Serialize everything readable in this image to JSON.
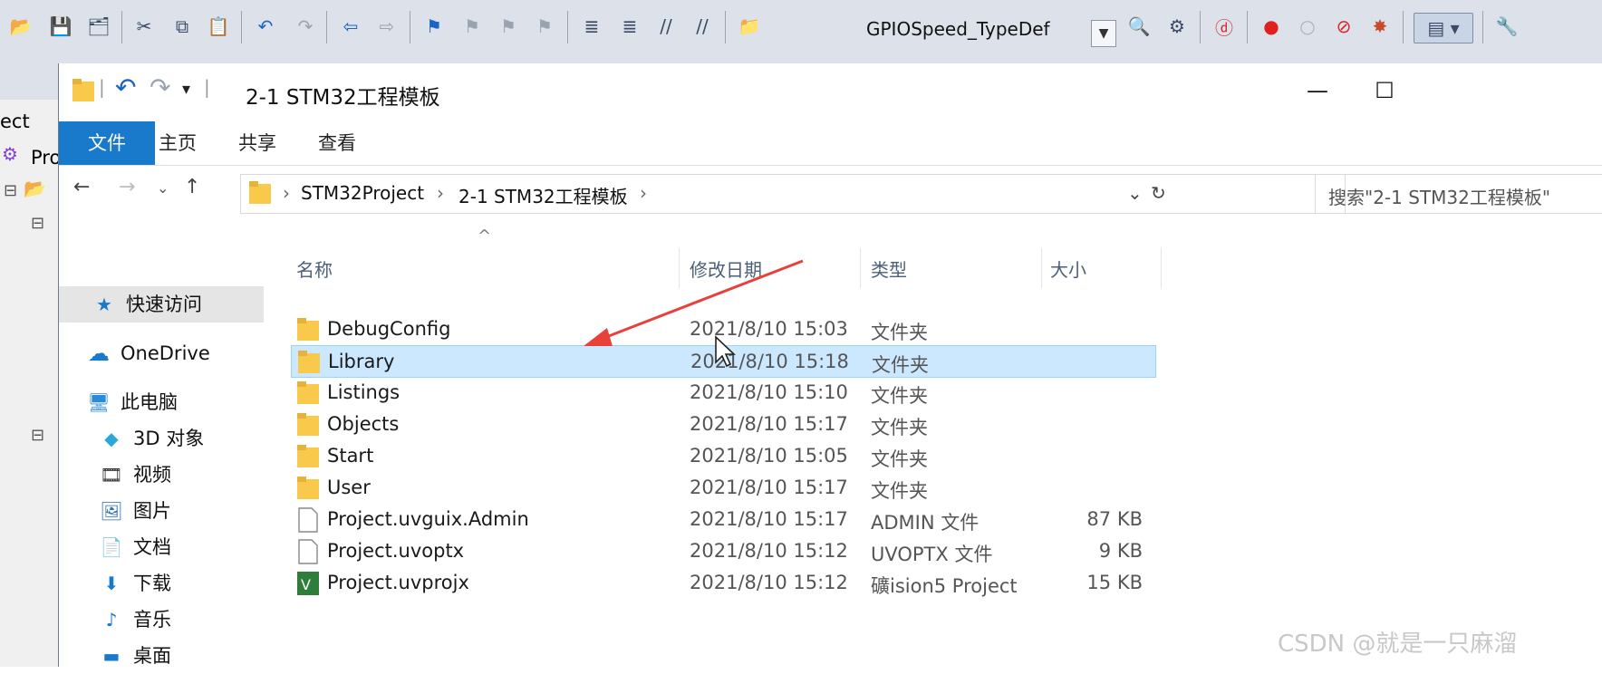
{
  "keil": {
    "device_combo": "GPIOSpeed_TypeDef",
    "left_texts": [
      "ect",
      "Pro"
    ],
    "toolbar_icons": [
      "open-icon",
      "save-icon",
      "save-all-icon",
      "cut-icon",
      "copy-icon",
      "paste-icon",
      "undo-icon",
      "redo-icon",
      "nav-back-icon",
      "nav-forward-icon",
      "bookmark-icon",
      "bookmark-prev-icon",
      "bookmark-next-icon",
      "bookmark-clear-icon",
      "indent-icon",
      "unindent-icon",
      "comment-icon",
      "uncomment-icon",
      "find-in-files-icon",
      "find-icon",
      "debug-icon",
      "breakpoint-icon",
      "breakpoint-disable-icon",
      "breakpoint-kill-icon",
      "breakpoint-all-icon",
      "window-layout-icon",
      "config-wrench-icon"
    ]
  },
  "explorer": {
    "title": "2-1 STM32工程模板",
    "window_buttons": [
      "—",
      "☐"
    ],
    "ribbon_tabs": [
      "文件",
      "主页",
      "共享",
      "查看"
    ],
    "breadcrumb": [
      "STM32Project",
      "2-1 STM32工程模板"
    ],
    "search_placeholder": "搜索\"2-1 STM32工程模板\"",
    "nav_items": [
      {
        "label": "快速访问",
        "icon": "star-icon"
      },
      {
        "label": "OneDrive",
        "icon": "cloud-icon"
      },
      {
        "label": "此电脑",
        "icon": "computer-icon"
      },
      {
        "label": "3D 对象",
        "icon": "cube-icon"
      },
      {
        "label": "视频",
        "icon": "video-icon"
      },
      {
        "label": "图片",
        "icon": "picture-icon"
      },
      {
        "label": "文档",
        "icon": "document-icon"
      },
      {
        "label": "下载",
        "icon": "download-icon"
      },
      {
        "label": "音乐",
        "icon": "music-icon"
      },
      {
        "label": "桌面",
        "icon": "desktop-icon"
      }
    ],
    "columns": [
      "名称",
      "修改日期",
      "类型",
      "大小"
    ],
    "files": [
      {
        "name": "DebugConfig",
        "date": "2021/8/10 15:03",
        "type": "文件夹",
        "size": "",
        "kind": "folder"
      },
      {
        "name": "Library",
        "date": "2021/8/10 15:18",
        "type": "文件夹",
        "size": "",
        "kind": "folder",
        "selected": true
      },
      {
        "name": "Listings",
        "date": "2021/8/10 15:10",
        "type": "文件夹",
        "size": "",
        "kind": "folder"
      },
      {
        "name": "Objects",
        "date": "2021/8/10 15:17",
        "type": "文件夹",
        "size": "",
        "kind": "folder"
      },
      {
        "name": "Start",
        "date": "2021/8/10 15:05",
        "type": "文件夹",
        "size": "",
        "kind": "folder"
      },
      {
        "name": "User",
        "date": "2021/8/10 15:17",
        "type": "文件夹",
        "size": "",
        "kind": "folder"
      },
      {
        "name": "Project.uvguix.Admin",
        "date": "2021/8/10 15:17",
        "type": "ADMIN 文件",
        "size": "87 KB",
        "kind": "file"
      },
      {
        "name": "Project.uvoptx",
        "date": "2021/8/10 15:12",
        "type": "UVOPTX 文件",
        "size": "9 KB",
        "kind": "file"
      },
      {
        "name": "Project.uvprojx",
        "date": "2021/8/10 15:12",
        "type": "礦ision5 Project",
        "size": "15 KB",
        "kind": "uvproj"
      }
    ]
  },
  "watermark": "CSDN @就是一只麻溜",
  "colors": {
    "file_tab": "#1979ca",
    "selection": "#cce8ff",
    "folder": "#f8c94a",
    "arrow": "#e8413a"
  }
}
